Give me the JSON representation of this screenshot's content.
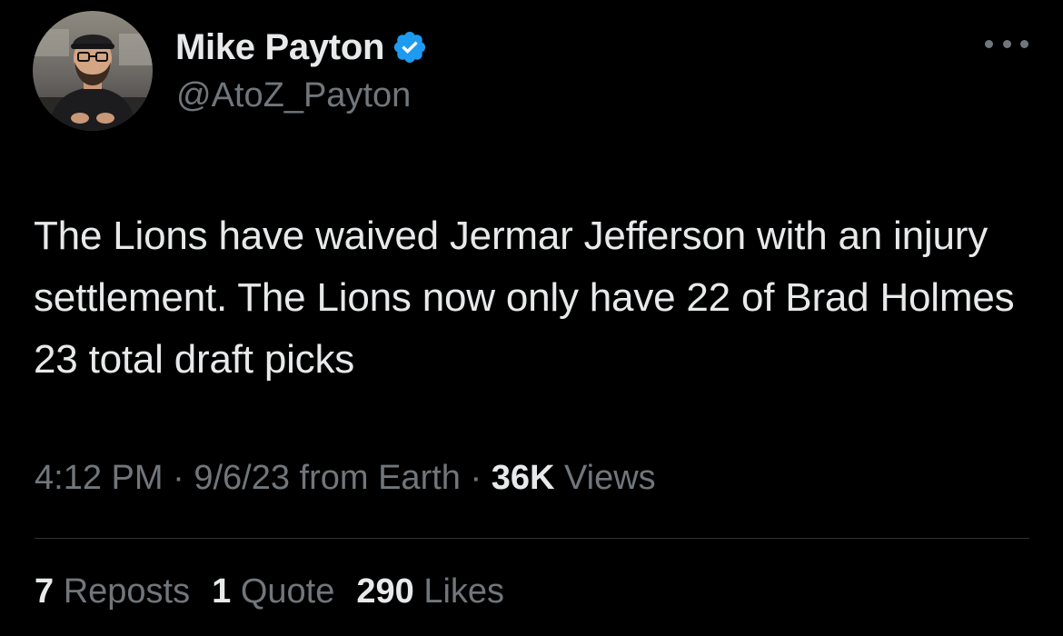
{
  "author": {
    "display_name": "Mike Payton",
    "handle": "@AtoZ_Payton",
    "verified": true
  },
  "tweet": {
    "text": "The Lions have waived Jermar Jefferson with an injury settlement. The Lions now only have 22 of Brad Holmes 23 total draft picks"
  },
  "meta": {
    "time": "4:12 PM",
    "separator": "·",
    "date": "9/6/23",
    "source": "from Earth",
    "views_count": "36K",
    "views_label": "Views"
  },
  "stats": {
    "reposts_count": "7",
    "reposts_label": "Reposts",
    "quotes_count": "1",
    "quotes_label": "Quote",
    "likes_count": "290",
    "likes_label": "Likes"
  },
  "icons": {
    "verified": "verified-badge-icon",
    "more": "more-options-icon"
  },
  "colors": {
    "background": "#000000",
    "primary_text": "#e7e9ea",
    "secondary_text": "#71767b",
    "verified_blue": "#1d9bf0",
    "divider": "#2f3336"
  }
}
